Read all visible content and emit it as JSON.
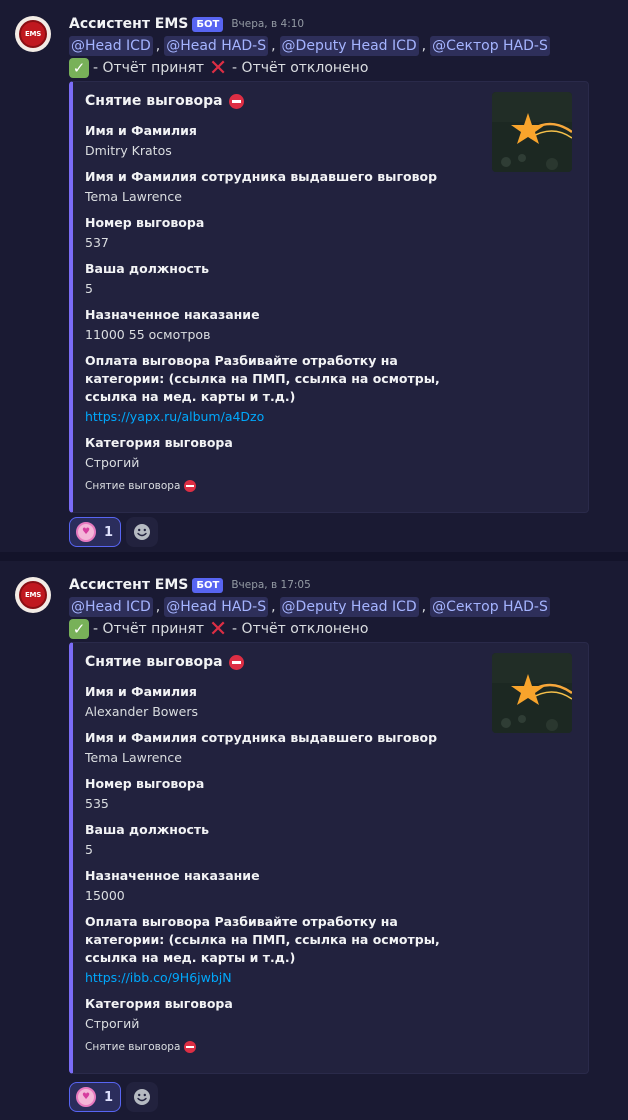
{
  "messages": [
    {
      "author": "Ассистент EMS",
      "bot_tag": "БОТ",
      "timestamp": "Вчера, в 4:10",
      "avatar_text": "EMS",
      "mentions": [
        "@Head ICD",
        "@Head HAD-S",
        "@Deputy Head ICD",
        "@Сектор HAD-S"
      ],
      "mention_separator": ",",
      "status_accepted": "- Отчёт принят",
      "status_rejected": "- Отчёт отклонено",
      "embed": {
        "title": "Снятие выговора",
        "title_icon": "no-entry-icon",
        "thumbnail_icon": "shooting-star-icon",
        "fields": [
          {
            "name": "Имя и Фамилия",
            "value": "Dmitry Kratos"
          },
          {
            "name": "Имя и Фамилия сотрудника выдавшего выговор",
            "value": "Tema Lawrence"
          },
          {
            "name": "Номер выговора",
            "value": "537"
          },
          {
            "name": "Ваша должность",
            "value": "5"
          },
          {
            "name": "Назначенное наказание",
            "value": "11000 55 осмотров"
          },
          {
            "name": "Оплата выговора Разбивайте отработку на категории: (ссылка на ПМП, ссылка на осмотры, ссылка на мед. карты и т.д.)",
            "value": "https://yapx.ru/album/a4Dzo"
          },
          {
            "name": "Категория выговора",
            "value": "Строгий"
          }
        ],
        "footer": "Снятие выговора",
        "accent_color": "#7b6cf6"
      },
      "reaction": {
        "emoji": "blob-heart-icon",
        "count": "1"
      }
    },
    {
      "author": "Ассистент EMS",
      "bot_tag": "БОТ",
      "timestamp": "Вчера, в 17:05",
      "avatar_text": "EMS",
      "mentions": [
        "@Head ICD",
        "@Head HAD-S",
        "@Deputy Head ICD",
        "@Сектор HAD-S"
      ],
      "mention_separator": ",",
      "status_accepted": "- Отчёт принят",
      "status_rejected": "- Отчёт отклонено",
      "embed": {
        "title": "Снятие выговора",
        "title_icon": "no-entry-icon",
        "thumbnail_icon": "shooting-star-icon",
        "fields": [
          {
            "name": "Имя и Фамилия",
            "value": "Alexander Bowers"
          },
          {
            "name": "Имя и Фамилия сотрудника выдавшего выговор",
            "value": "Tema Lawrence"
          },
          {
            "name": "Номер выговора",
            "value": "535"
          },
          {
            "name": "Ваша должность",
            "value": "5"
          },
          {
            "name": "Назначенное наказание",
            "value": "15000"
          },
          {
            "name": "Оплата выговора Разбивайте отработку на категории: (ссылка на ПМП, ссылка на осмотры, ссылка на мед. карты и т.д.)",
            "value": "https://ibb.co/9H6jwbjN"
          },
          {
            "name": "Категория выговора",
            "value": "Строгий"
          }
        ],
        "footer": "Снятие выговора",
        "accent_color": "#7b6cf6"
      },
      "reaction": {
        "emoji": "blob-heart-icon",
        "count": "1"
      }
    }
  ],
  "colors": {
    "background": "#13132a",
    "message_background": "#1a1a33",
    "embed_background": "#22223e",
    "mention_text": "#a5b4ff",
    "link": "#00a8fc",
    "bot_tag": "#5865f2"
  }
}
